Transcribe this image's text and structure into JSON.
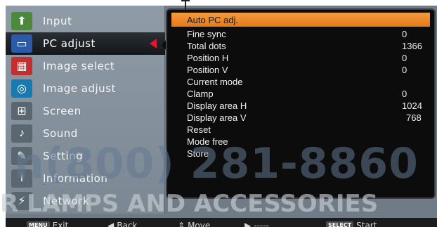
{
  "menu": {
    "items": [
      {
        "label": "Input",
        "icon": "input-icon",
        "color": "#4a8a3a"
      },
      {
        "label": "PC adjust",
        "icon": "monitor-icon",
        "color": "#2a5aa8"
      },
      {
        "label": "Image select",
        "icon": "image-select-icon",
        "color": "#c03030"
      },
      {
        "label": "Image adjust",
        "icon": "image-adjust-icon",
        "color": "#1a7ab0"
      },
      {
        "label": "Screen",
        "icon": "screen-icon",
        "color": "#5a6670"
      },
      {
        "label": "Sound",
        "icon": "speaker-icon",
        "color": "#5a6670"
      },
      {
        "label": "Setting",
        "icon": "tools-icon",
        "color": "#5a6670"
      },
      {
        "label": "Information",
        "icon": "info-person-icon",
        "color": "#5a6670"
      },
      {
        "label": "Network",
        "icon": "network-icon",
        "color": "#5a6670"
      }
    ],
    "active_index": 1
  },
  "panel": {
    "rows": [
      {
        "name": "Auto PC adj.",
        "value": ""
      },
      {
        "name": "Fine sync",
        "value": "0"
      },
      {
        "name": "Total dots",
        "value": "1366"
      },
      {
        "name": "Position H",
        "value": "0"
      },
      {
        "name": "Position V",
        "value": "0"
      },
      {
        "name": "Current mode",
        "value": ""
      },
      {
        "name": "Clamp",
        "value": "0"
      },
      {
        "name": "Display area H",
        "value": "1024"
      },
      {
        "name": "Display area V",
        "value": "768"
      },
      {
        "name": "Reset",
        "value": ""
      },
      {
        "name": "Mode free",
        "value": ""
      },
      {
        "name": "Store",
        "value": ""
      }
    ],
    "highlight_index": 0
  },
  "bottom_bar": {
    "exit": {
      "key": "MENU",
      "label": "Exit"
    },
    "back": {
      "key": "◀",
      "label": "Back"
    },
    "move": {
      "key": "⇕",
      "label": "Move"
    },
    "next": {
      "key": "▶",
      "label": "-----"
    },
    "start": {
      "key": "SELECT",
      "label": "Start"
    }
  },
  "watermark": {
    "phone": "n(800) 281-8860",
    "text": "R LAMPS AND ACCESSORIES"
  },
  "colors": {
    "highlight": "#f08a2a",
    "active_arrow": "#e0182a",
    "panel_bg": "#0c0c0c"
  }
}
